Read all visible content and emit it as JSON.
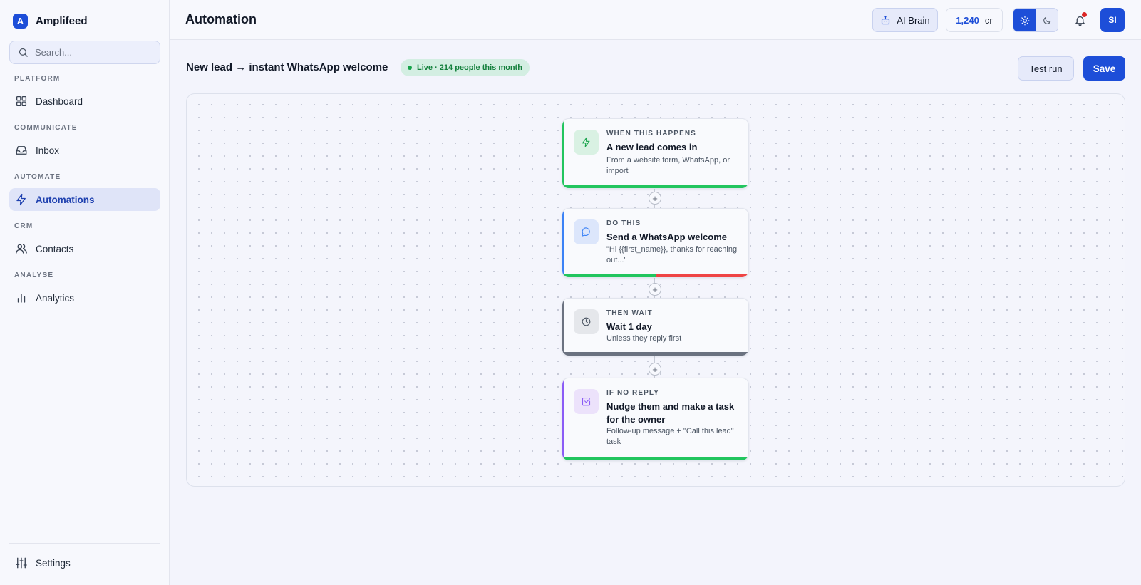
{
  "app": {
    "brand_initial": "A",
    "brand_name": "Amplifeed"
  },
  "sidebar": {
    "search_placeholder": "Search...",
    "sections": [
      {
        "label": "PLATFORM",
        "items": [
          {
            "label": "Dashboard",
            "icon": "grid-icon"
          }
        ]
      },
      {
        "label": "COMMUNICATE",
        "items": [
          {
            "label": "Inbox",
            "icon": "inbox-icon"
          }
        ]
      },
      {
        "label": "AUTOMATE",
        "items": [
          {
            "label": "Automations",
            "icon": "lightning-icon",
            "active": true
          }
        ]
      },
      {
        "label": "CRM",
        "items": [
          {
            "label": "Contacts",
            "icon": "users-icon"
          }
        ]
      },
      {
        "label": "ANALYSE",
        "items": [
          {
            "label": "Analytics",
            "icon": "bar-chart-icon"
          }
        ]
      }
    ],
    "settings_label": "Settings"
  },
  "header": {
    "title": "Automation",
    "ai_brain_label": "AI Brain",
    "credits_value": "1,240",
    "credits_unit": "cr",
    "theme": "light",
    "notifications_unread": true,
    "avatar_initials": "SI"
  },
  "flow": {
    "name": "New lead → instant WhatsApp welcome",
    "status": "Live · 214 people this month",
    "test_run_label": "Test run",
    "save_label": "Save",
    "add_step_symbol": "+",
    "nodes": [
      {
        "kicker": "WHEN THIS HAPPENS",
        "title": "A new lead comes in",
        "description": "From a website form, WhatsApp, or import",
        "icon": "lightning-icon",
        "accent": "#22c55e",
        "bottom_bar": [
          "#22c55e"
        ]
      },
      {
        "kicker": "DO THIS",
        "title": "Send a WhatsApp welcome",
        "description": "\"Hi {{first_name}}, thanks for reaching out...\"",
        "icon": "chat-bubble-icon",
        "accent": "#3b82f6",
        "bottom_bar": [
          "#22c55e",
          "#ef4444"
        ]
      },
      {
        "kicker": "THEN WAIT",
        "title": "Wait 1 day",
        "description": "Unless they reply first",
        "icon": "clock-icon",
        "accent": "#6b7280",
        "bottom_bar": [
          "#6b7280"
        ]
      },
      {
        "kicker": "IF NO REPLY",
        "title": "Nudge them and make a task for the owner",
        "description": "Follow-up message + \"Call this lead\" task",
        "icon": "checkbox-icon",
        "accent": "#8b5cf6",
        "bottom_bar": [
          "#22c55e"
        ]
      }
    ]
  },
  "colors": {
    "primary": "#1d4ed8",
    "live_green": "#16a34a",
    "notification_red": "#dc2626"
  }
}
